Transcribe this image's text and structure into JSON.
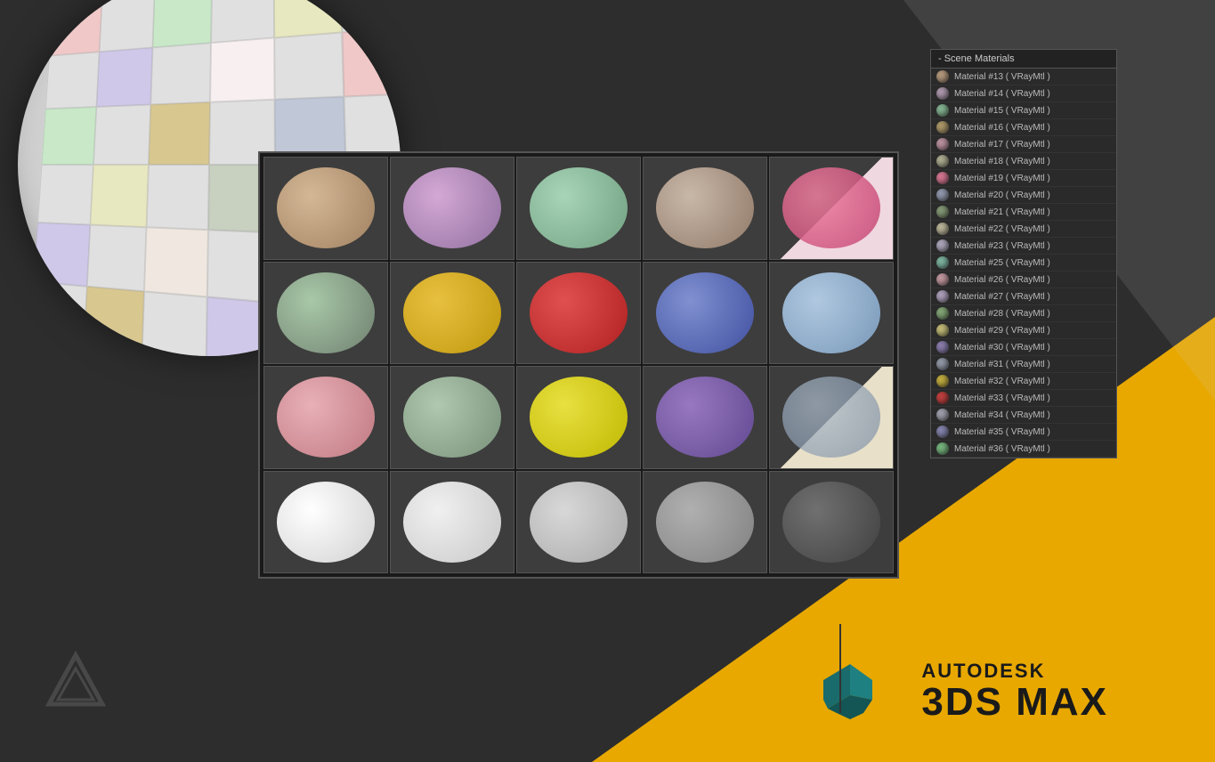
{
  "app": {
    "title": "Autodesk 3DS MAX - Scene Materials"
  },
  "panel": {
    "header": "- Scene Materials",
    "items": [
      {
        "id": 13,
        "label": "Material #13 ( VRayMtl )",
        "color": "#c8a888"
      },
      {
        "id": 14,
        "label": "Material #14 ( VRayMtl )",
        "color": "#c0a8c0"
      },
      {
        "id": 15,
        "label": "Material #15 ( VRayMtl )",
        "color": "#90c8a0"
      },
      {
        "id": 16,
        "label": "Material #16 ( VRayMtl )",
        "color": "#c0a870"
      },
      {
        "id": 17,
        "label": "Material #17 ( VRayMtl )",
        "color": "#d0a0b0"
      },
      {
        "id": 18,
        "label": "Material #18 ( VRayMtl )",
        "color": "#c0c0a0"
      },
      {
        "id": 19,
        "label": "Material #19 ( VRayMtl )",
        "color": "#f080a0"
      },
      {
        "id": 20,
        "label": "Material #20 ( VRayMtl )",
        "color": "#a0a8c0"
      },
      {
        "id": 21,
        "label": "Material #21 ( VRayMtl )",
        "color": "#90a880"
      },
      {
        "id": 22,
        "label": "Material #22 ( VRayMtl )",
        "color": "#d0c8a8"
      },
      {
        "id": 23,
        "label": "Material #23 ( VRayMtl )",
        "color": "#c0b8d0"
      },
      {
        "id": 25,
        "label": "Material #25 ( VRayMtl )",
        "color": "#88c8b0"
      },
      {
        "id": 26,
        "label": "Material #26 ( VRayMtl )",
        "color": "#d8a8b0"
      },
      {
        "id": 27,
        "label": "Material #27 ( VRayMtl )",
        "color": "#c0b0d0"
      },
      {
        "id": 28,
        "label": "Material #28 ( VRayMtl )",
        "color": "#90b880"
      },
      {
        "id": 29,
        "label": "Material #29 ( VRayMtl )",
        "color": "#d8d080"
      },
      {
        "id": 30,
        "label": "Material #30 ( VRayMtl )",
        "color": "#9888c0"
      },
      {
        "id": 31,
        "label": "Material #31 ( VRayMtl )",
        "color": "#a0a8b8"
      },
      {
        "id": 32,
        "label": "Material #32 ( VRayMtl )",
        "color": "#d8c040"
      },
      {
        "id": 33,
        "label": "Material #33 ( VRayMtl )",
        "color": "#d84040"
      },
      {
        "id": 34,
        "label": "Material #34 ( VRayMtl )",
        "color": "#b0b0c0"
      },
      {
        "id": 35,
        "label": "Material #35 ( VRayMtl )",
        "color": "#9090c0"
      },
      {
        "id": 36,
        "label": "Material #36 ( VRayMtl )",
        "color": "#80c888"
      }
    ]
  },
  "logo": {
    "brand": "AUTODESK",
    "product": "3DS MAX"
  },
  "materials": [
    {
      "class": "sphere-sand",
      "row": 0,
      "col": 0
    },
    {
      "class": "sphere-lavender",
      "row": 0,
      "col": 1
    },
    {
      "class": "sphere-mint",
      "row": 0,
      "col": 2
    },
    {
      "class": "sphere-taupe",
      "row": 0,
      "col": 3
    },
    {
      "class": "sphere-pink-hot",
      "row": 0,
      "col": 4
    },
    {
      "class": "sphere-green-light",
      "row": 1,
      "col": 0
    },
    {
      "class": "sphere-yellow",
      "row": 1,
      "col": 1
    },
    {
      "class": "sphere-red",
      "row": 1,
      "col": 2
    },
    {
      "class": "sphere-blue-purple",
      "row": 1,
      "col": 3
    },
    {
      "class": "sphere-sky",
      "row": 1,
      "col": 4
    },
    {
      "class": "sphere-pale-green",
      "row": 1,
      "col": 5
    },
    {
      "class": "sphere-pink-soft",
      "row": 2,
      "col": 0
    },
    {
      "class": "sphere-sage",
      "row": 2,
      "col": 1
    },
    {
      "class": "sphere-yellow-bright",
      "row": 2,
      "col": 2
    },
    {
      "class": "sphere-purple",
      "row": 2,
      "col": 3
    },
    {
      "class": "sphere-blue-grey",
      "row": 2,
      "col": 4
    },
    {
      "class": "sphere-white",
      "row": 3,
      "col": 0
    },
    {
      "class": "sphere-white2",
      "row": 3,
      "col": 1
    },
    {
      "class": "sphere-grey-light",
      "row": 3,
      "col": 2
    },
    {
      "class": "sphere-grey-mid",
      "row": 3,
      "col": 3
    },
    {
      "class": "sphere-grey-dark",
      "row": 3,
      "col": 4
    }
  ]
}
